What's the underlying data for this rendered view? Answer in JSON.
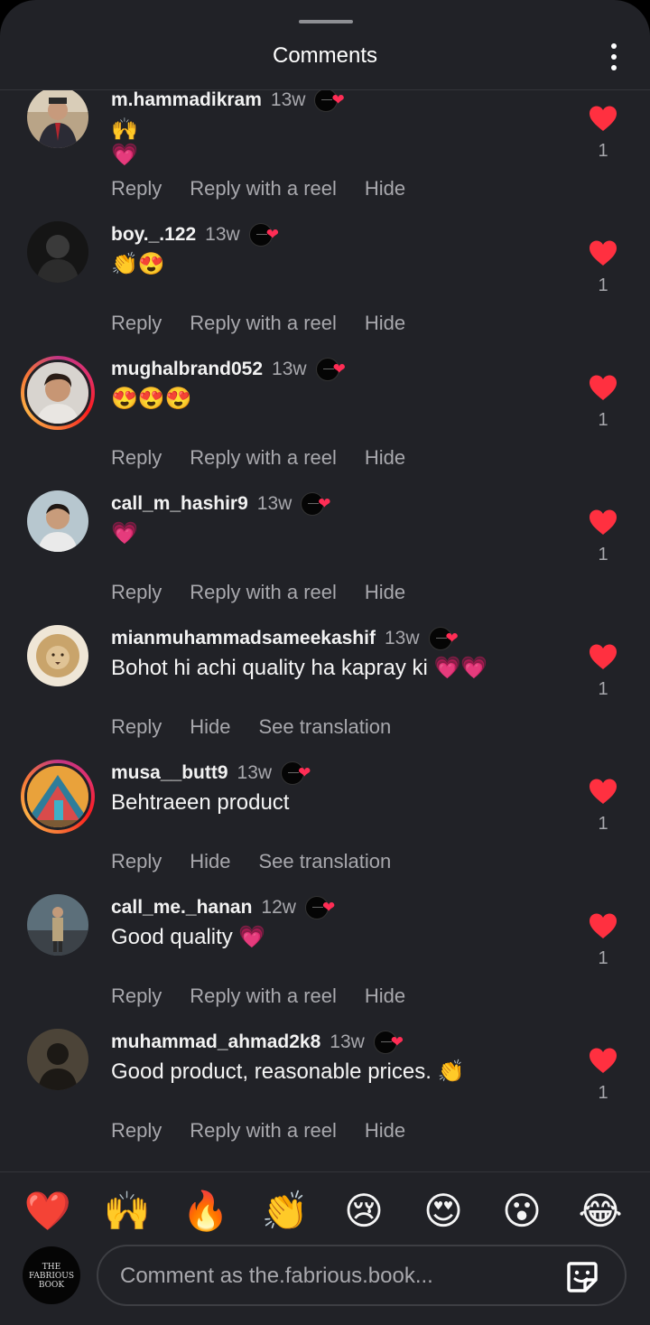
{
  "header": {
    "title": "Comments",
    "more_icon": "more-vertical-icon"
  },
  "actions_labels": {
    "reply": "Reply",
    "reply_reel": "Reply with a reel",
    "hide": "Hide",
    "see_translation": "See translation"
  },
  "comments": [
    {
      "username": "m.hammadikram",
      "time": "13w",
      "text": "🙌\n💗",
      "likes": "1",
      "avatar": "man-suit-avatar",
      "ring": false,
      "actions": [
        "Reply",
        "Reply with a reel",
        "Hide"
      ]
    },
    {
      "username": "boy._.122",
      "time": "13w",
      "text": "👏😍",
      "likes": "1",
      "avatar": "dark-figure-avatar",
      "ring": false,
      "actions": [
        "Reply",
        "Reply with a reel",
        "Hide"
      ]
    },
    {
      "username": "mughalbrand052",
      "time": "13w",
      "text": "😍😍😍",
      "likes": "1",
      "avatar": "smiling-man-avatar",
      "ring": true,
      "actions": [
        "Reply",
        "Reply with a reel",
        "Hide"
      ]
    },
    {
      "username": "call_m_hashir9",
      "time": "13w",
      "text": "💗",
      "likes": "1",
      "avatar": "boy-avatar",
      "ring": false,
      "actions": [
        "Reply",
        "Reply with a reel",
        "Hide"
      ]
    },
    {
      "username": "mianmuhammadsameekashif",
      "time": "13w",
      "text": "Bohot hi achi quality ha kapray ki 💗💗",
      "likes": "1",
      "avatar": "lion-avatar",
      "ring": false,
      "actions": [
        "Reply",
        "Hide",
        "See translation"
      ]
    },
    {
      "username": "musa__butt9",
      "time": "13w",
      "text": "Behtraeen product",
      "likes": "1",
      "avatar": "colorful-tent-avatar",
      "ring": true,
      "actions": [
        "Reply",
        "Hide",
        "See translation"
      ]
    },
    {
      "username": "call_me._hanan",
      "time": "12w",
      "text": "Good quality 💗",
      "likes": "1",
      "avatar": "standing-man-avatar",
      "ring": false,
      "actions": [
        "Reply",
        "Reply with a reel",
        "Hide"
      ]
    },
    {
      "username": "muhammad_ahmad2k8",
      "time": "13w",
      "text": "Good product, reasonable prices. 👏",
      "likes": "1",
      "avatar": "silhouette-avatar",
      "ring": false,
      "actions": [
        "Reply",
        "Reply with a reel",
        "Hide"
      ]
    }
  ],
  "reactions": [
    "❤️",
    "🙌",
    "🔥",
    "👏",
    "😢",
    "😍",
    "😮",
    "😂"
  ],
  "composer": {
    "placeholder": "Comment as the.fabrious.book...",
    "avatar_text": "THE FABRIOUS BOOK",
    "sticker_icon": "sticker-icon"
  },
  "colors": {
    "background": "#212227",
    "like_red": "#ff3040",
    "muted_text": "#a8a8ad"
  }
}
